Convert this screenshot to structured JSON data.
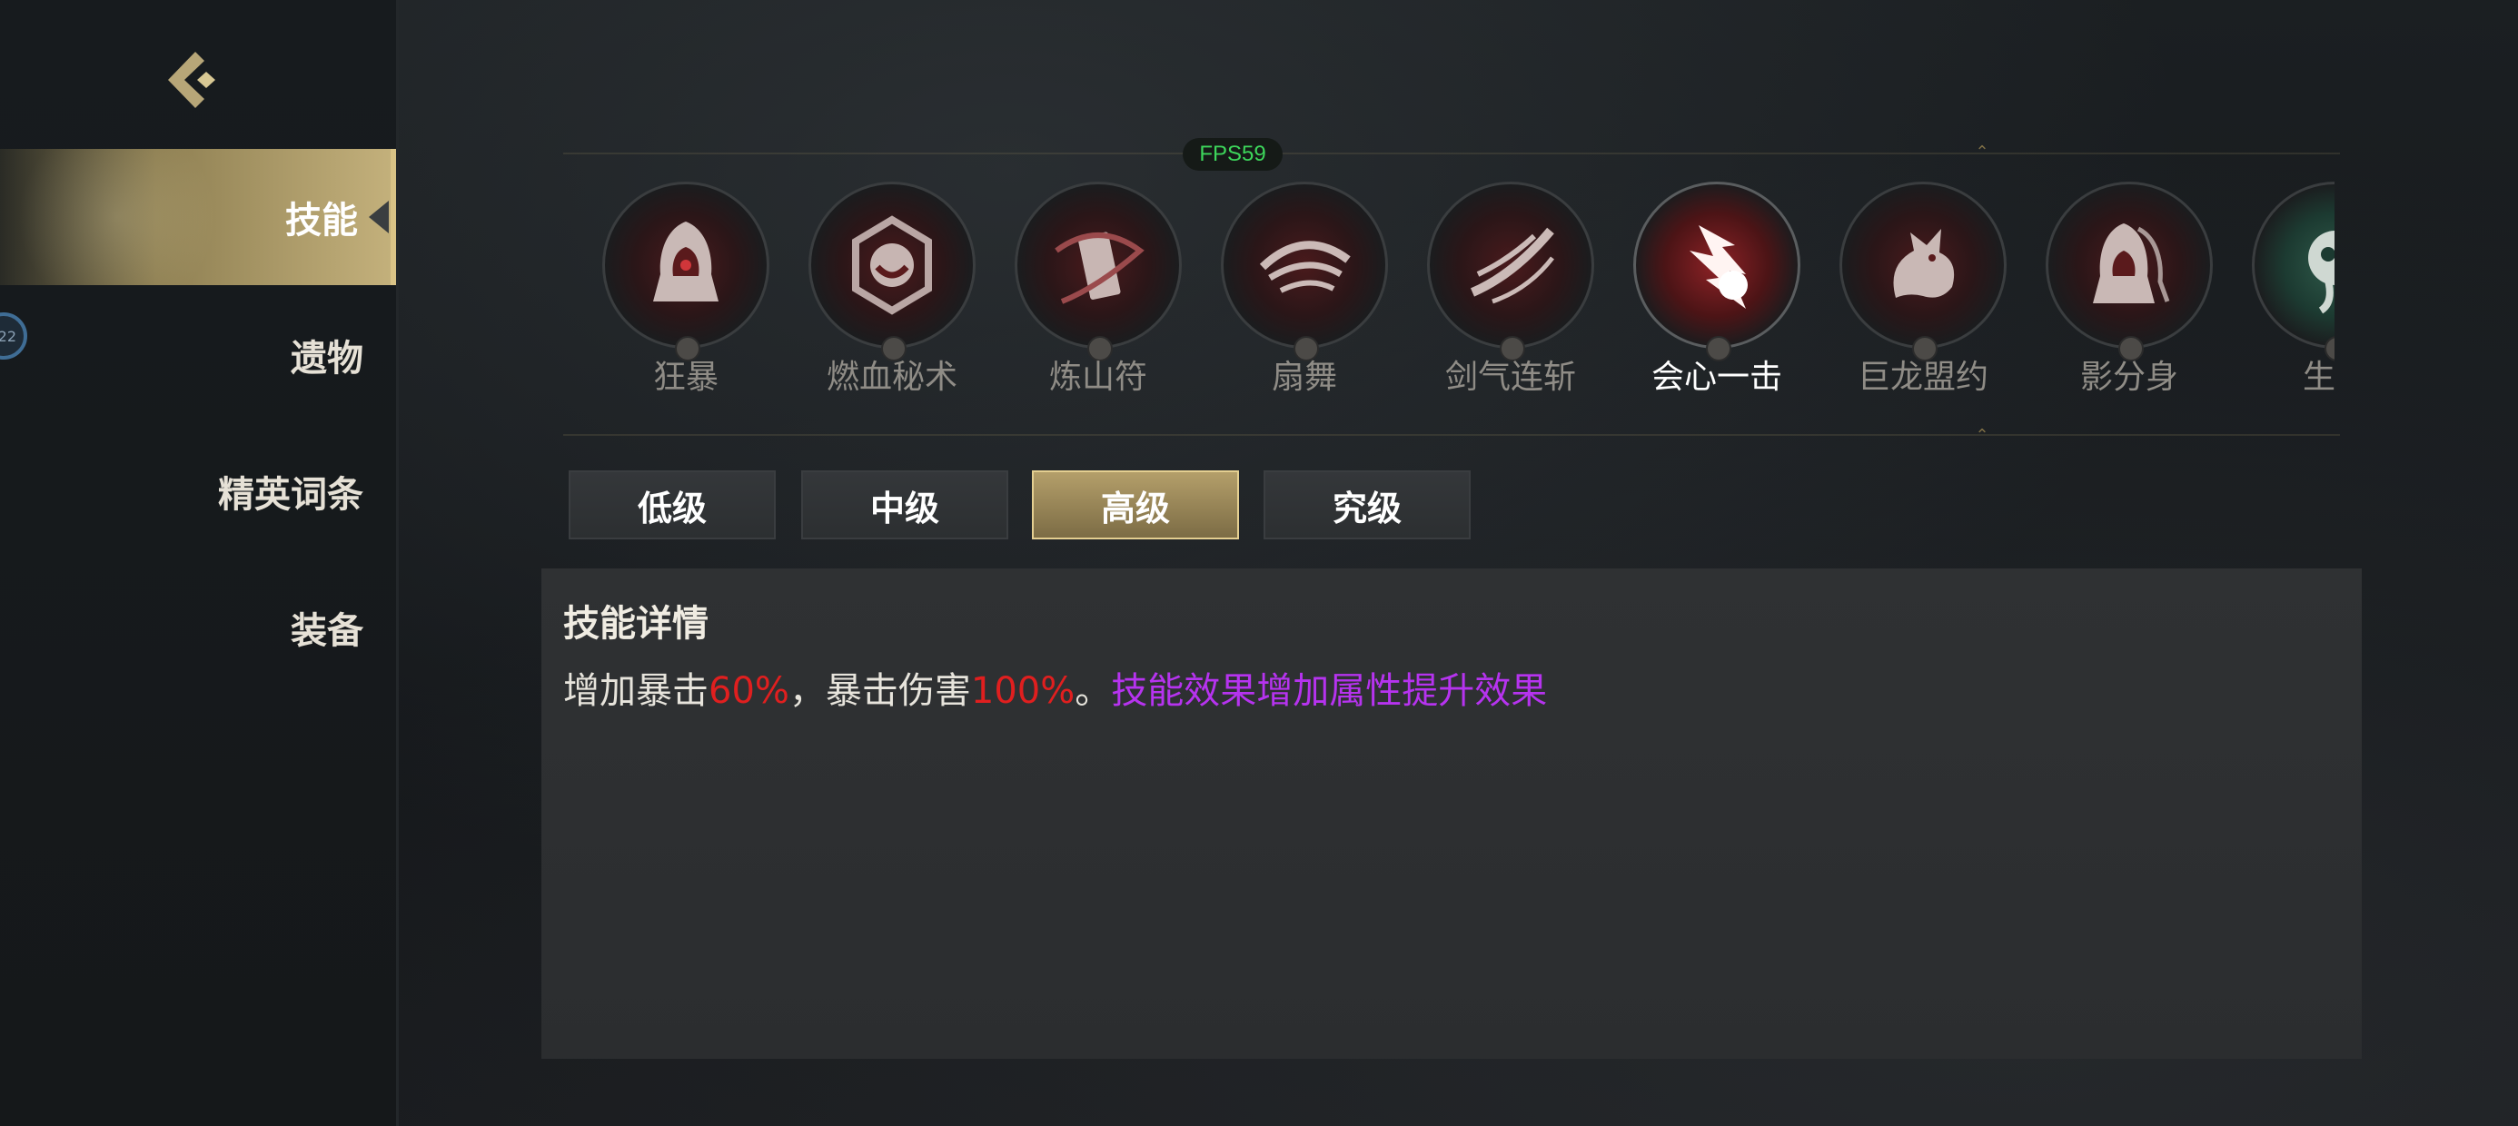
{
  "colors": {
    "accent_gold": "#c3b07b",
    "highlight_red": "#e01f1f",
    "highlight_purple": "#b633ef",
    "fps_green": "#3dd65b"
  },
  "sidebar": {
    "back_icon": "back-chevron-icon",
    "avatar_text": "22",
    "items": [
      {
        "label": "技能",
        "active": true
      },
      {
        "label": "遗物",
        "active": false
      },
      {
        "label": "精英词条",
        "active": false
      },
      {
        "label": "装备",
        "active": false
      }
    ]
  },
  "fps": "FPS59",
  "skills": [
    {
      "label": "狂暴",
      "icon": "hooded-figure-icon",
      "selected": false
    },
    {
      "label": "燃血秘术",
      "icon": "blood-rune-icon",
      "selected": false
    },
    {
      "label": "炼山符",
      "icon": "talisman-icon",
      "selected": false
    },
    {
      "label": "扇舞",
      "icon": "fan-dance-icon",
      "selected": false
    },
    {
      "label": "剑气连斩",
      "icon": "sword-slash-icon",
      "selected": false
    },
    {
      "label": "会心一击",
      "icon": "critical-strike-icon",
      "selected": true
    },
    {
      "label": "巨龙盟约",
      "icon": "dragon-icon",
      "selected": false
    },
    {
      "label": "影分身",
      "icon": "shadow-clone-icon",
      "selected": false
    },
    {
      "label": "生命",
      "icon": "life-icon",
      "selected": false
    }
  ],
  "grades": [
    {
      "label": "低级",
      "active": false
    },
    {
      "label": "中级",
      "active": false
    },
    {
      "label": "高级",
      "active": true
    },
    {
      "label": "究级",
      "active": false
    }
  ],
  "detail": {
    "title": "技能详情",
    "parts": [
      {
        "text": "增加暴击",
        "style": "normal"
      },
      {
        "text": "60%",
        "style": "red"
      },
      {
        "text": "，暴击伤害",
        "style": "normal"
      },
      {
        "text": "100%",
        "style": "red"
      },
      {
        "text": "。",
        "style": "normal"
      },
      {
        "text": "技能效果增加属性提升效果",
        "style": "purple"
      }
    ]
  }
}
